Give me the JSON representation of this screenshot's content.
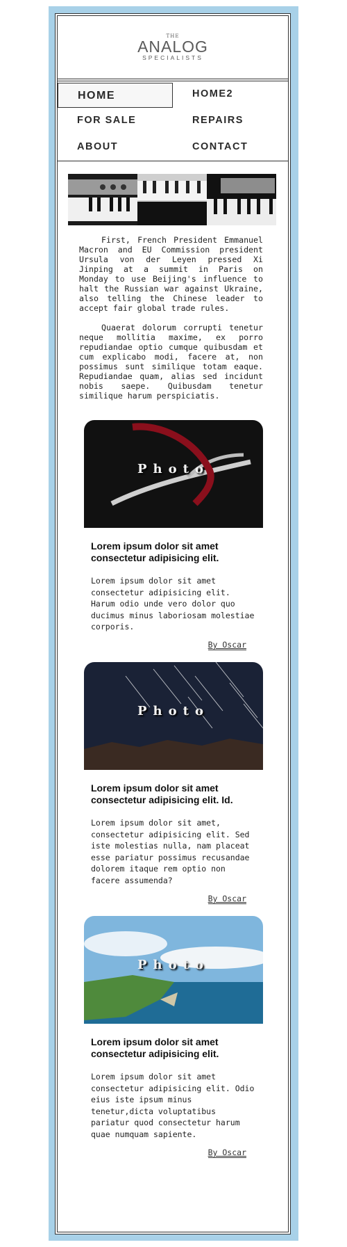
{
  "site": {
    "logo_the": "THE",
    "logo_main": "ANALOG",
    "logo_sub": "SPECIALISTS"
  },
  "nav": [
    {
      "label": "HOME",
      "active": true
    },
    {
      "label": "HOME2"
    },
    {
      "label": "FOR SALE"
    },
    {
      "label": "REPAIRS"
    },
    {
      "label": "ABOUT"
    },
    {
      "label": "CONTACT"
    }
  ],
  "intro": {
    "p1": "First, French President Emmanuel Macron and EU Commission president Ursula von der Leyen pressed Xi Jinping at a summit in Paris on Monday to use Beijing's influence to halt the Russian war against Ukraine, also telling the Chinese leader to accept fair global trade rules.",
    "p2": "Quaerat dolorum corrupti tenetur neque mollitia maxime, ex porro repudiandae optio cumque quibusdam et cum explicabo modi, facere at, non possimus sunt similique totam eaque. Repudiandae quam, alias sed incidunt nobis saepe. Quibusdam tenetur similique harum perspiciatis."
  },
  "cards": [
    {
      "photo_label": "Photo",
      "title": "Lorem ipsum dolor sit amet consectetur adipisicing elit.",
      "text": "Lorem ipsum dolor sit amet consectetur adipisicing elit. Harum odio unde vero dolor quo ducimus minus laboriosam molestiae corporis.",
      "byline": "By Oscar"
    },
    {
      "photo_label": "Photo",
      "title": "Lorem ipsum dolor sit amet consectetur adipisicing elit. Id.",
      "text": "Lorem ipsum dolor sit amet, consectetur adipisicing elit. Sed iste molestias nulla, nam placeat esse pariatur possimus recusandae dolorem itaque rem optio non facere assumenda?",
      "byline": "By Oscar"
    },
    {
      "photo_label": "Photo",
      "title": "Lorem ipsum dolor sit amet consectetur adipisicing elit.",
      "text": "Lorem ipsum dolor sit amet consectetur adipisicing elit. Odio eius iste ipsum minus tenetur,dicta voluptatibus pariatur quod consectetur harum quae numquam sapiente.",
      "byline": "By Oscar"
    }
  ],
  "colors": {
    "frame": "#a8d1e8",
    "text": "#222222"
  }
}
